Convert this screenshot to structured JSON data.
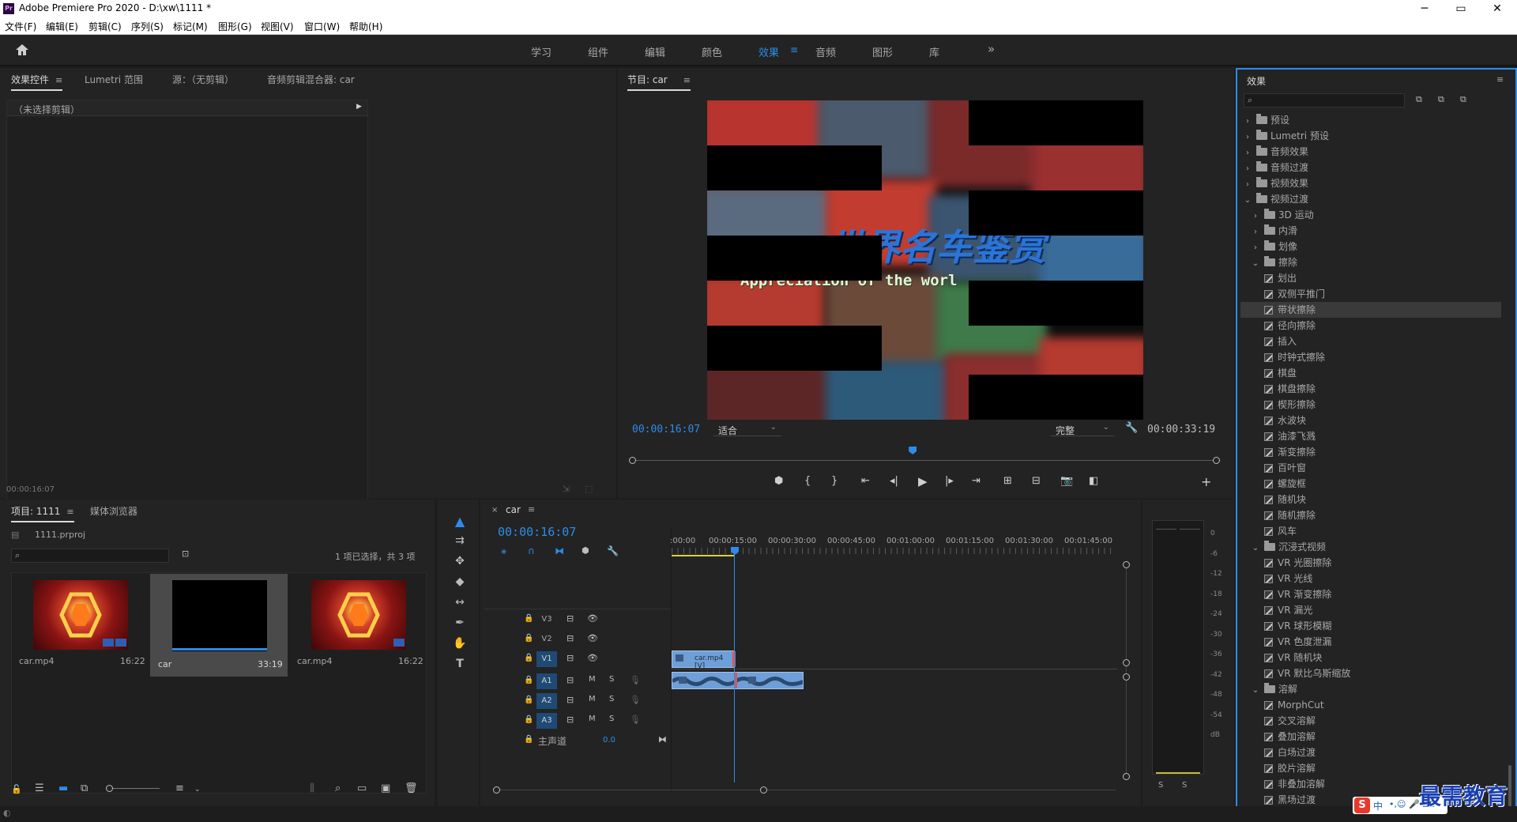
{
  "app": {
    "title": "Adobe Premiere Pro 2020 - D:\\xw\\1111 *",
    "logo": "Pr"
  },
  "window_controls": {
    "minimize": "─",
    "maximize": "▭",
    "close": "✕"
  },
  "menu": [
    "文件(F)",
    "编辑(E)",
    "剪辑(C)",
    "序列(S)",
    "标记(M)",
    "图形(G)",
    "视图(V)",
    "窗口(W)",
    "帮助(H)"
  ],
  "workspaces": {
    "tabs": [
      "学习",
      "组件",
      "编辑",
      "颜色",
      "效果",
      "音频",
      "图形",
      "库"
    ],
    "active": "效果",
    "overflow": "»"
  },
  "effect_controls": {
    "tabs": [
      "效果控件",
      "Lumetri 范围",
      "源：（无剪辑）",
      "音频剪辑混合器: car"
    ],
    "no_clip": "（未选择剪辑）",
    "timecode": "00:00:16:07"
  },
  "program_monitor": {
    "tab": "节目: car",
    "overlay_title": "世界名车鉴赏",
    "overlay_subtitle": "Appreciation of the worl",
    "current_tc": "00:00:16:07",
    "fit": "适合",
    "quality": "完整",
    "duration_tc": "00:00:33:19",
    "playhead_fraction": 0.48
  },
  "project": {
    "tabs": [
      "项目: 1111",
      "媒体浏览器"
    ],
    "file": "1111.prproj",
    "selection_info": "1 项已选择，共 3 项",
    "items": [
      {
        "name": "car.mp4",
        "duration": "16:22",
        "kind": "video-red"
      },
      {
        "name": "car",
        "duration": "33:19",
        "kind": "sequence"
      },
      {
        "name": "car.mp4",
        "duration": "16:22",
        "kind": "video-red"
      }
    ]
  },
  "timeline": {
    "tab": "car",
    "timecode": "00:00:16:07",
    "ruler": [
      ":00:00",
      "00:00:15:00",
      "00:00:30:00",
      "00:00:45:00",
      "00:01:00:00",
      "00:01:15:00",
      "00:01:30:00",
      "00:01:45:00"
    ],
    "video_tracks": [
      "V3",
      "V2",
      "V1"
    ],
    "audio_tracks": [
      "A1",
      "A2",
      "A3"
    ],
    "master_label": "主声道",
    "master_value": "0.0",
    "clip_label": "car.mp4 [V]",
    "track_m": "M",
    "track_s": "S"
  },
  "audio_meter": {
    "scale": [
      "0",
      "-6",
      "-12",
      "-18",
      "-24",
      "-30",
      "-36",
      "-42",
      "-48",
      "-54",
      "dB"
    ],
    "solo": [
      "S",
      "S"
    ]
  },
  "effects_panel": {
    "title": "效果",
    "tree": [
      {
        "label": "预设",
        "level": 0,
        "type": "folder",
        "open": false
      },
      {
        "label": "Lumetri 预设",
        "level": 0,
        "type": "folder",
        "open": false
      },
      {
        "label": "音频效果",
        "level": 0,
        "type": "folder",
        "open": false
      },
      {
        "label": "音频过渡",
        "level": 0,
        "type": "folder",
        "open": false
      },
      {
        "label": "视频效果",
        "level": 0,
        "type": "folder",
        "open": false
      },
      {
        "label": "视频过渡",
        "level": 0,
        "type": "folder",
        "open": true
      },
      {
        "label": "3D 运动",
        "level": 1,
        "type": "folder",
        "open": false
      },
      {
        "label": "内滑",
        "level": 1,
        "type": "folder",
        "open": false
      },
      {
        "label": "划像",
        "level": 1,
        "type": "folder",
        "open": false
      },
      {
        "label": "擦除",
        "level": 1,
        "type": "folder",
        "open": true
      },
      {
        "label": "划出",
        "level": 2,
        "type": "effect"
      },
      {
        "label": "双侧平推门",
        "level": 2,
        "type": "effect"
      },
      {
        "label": "带状擦除",
        "level": 2,
        "type": "effect",
        "selected": true
      },
      {
        "label": "径向擦除",
        "level": 2,
        "type": "effect"
      },
      {
        "label": "插入",
        "level": 2,
        "type": "effect"
      },
      {
        "label": "时钟式擦除",
        "level": 2,
        "type": "effect"
      },
      {
        "label": "棋盘",
        "level": 2,
        "type": "effect"
      },
      {
        "label": "棋盘擦除",
        "level": 2,
        "type": "effect"
      },
      {
        "label": "楔形擦除",
        "level": 2,
        "type": "effect"
      },
      {
        "label": "水波块",
        "level": 2,
        "type": "effect"
      },
      {
        "label": "油漆飞溅",
        "level": 2,
        "type": "effect"
      },
      {
        "label": "渐变擦除",
        "level": 2,
        "type": "effect"
      },
      {
        "label": "百叶窗",
        "level": 2,
        "type": "effect"
      },
      {
        "label": "螺旋框",
        "level": 2,
        "type": "effect"
      },
      {
        "label": "随机块",
        "level": 2,
        "type": "effect"
      },
      {
        "label": "随机擦除",
        "level": 2,
        "type": "effect"
      },
      {
        "label": "风车",
        "level": 2,
        "type": "effect"
      },
      {
        "label": "沉浸式视频",
        "level": 1,
        "type": "folder",
        "open": true
      },
      {
        "label": "VR 光圈擦除",
        "level": 2,
        "type": "effect"
      },
      {
        "label": "VR 光线",
        "level": 2,
        "type": "effect"
      },
      {
        "label": "VR 渐变擦除",
        "level": 2,
        "type": "effect"
      },
      {
        "label": "VR 漏光",
        "level": 2,
        "type": "effect"
      },
      {
        "label": "VR 球形模糊",
        "level": 2,
        "type": "effect"
      },
      {
        "label": "VR 色度泄漏",
        "level": 2,
        "type": "effect"
      },
      {
        "label": "VR 随机块",
        "level": 2,
        "type": "effect"
      },
      {
        "label": "VR 默比乌斯缩放",
        "level": 2,
        "type": "effect"
      },
      {
        "label": "溶解",
        "level": 1,
        "type": "folder",
        "open": true
      },
      {
        "label": "MorphCut",
        "level": 2,
        "type": "effect"
      },
      {
        "label": "交叉溶解",
        "level": 2,
        "type": "effect"
      },
      {
        "label": "叠加溶解",
        "level": 2,
        "type": "effect"
      },
      {
        "label": "白场过渡",
        "level": 2,
        "type": "effect"
      },
      {
        "label": "胶片溶解",
        "level": 2,
        "type": "effect"
      },
      {
        "label": "非叠加溶解",
        "level": 2,
        "type": "effect"
      },
      {
        "label": "黑场过渡",
        "level": 2,
        "type": "effect"
      }
    ]
  },
  "watermark": "最需教育",
  "ime": "中"
}
